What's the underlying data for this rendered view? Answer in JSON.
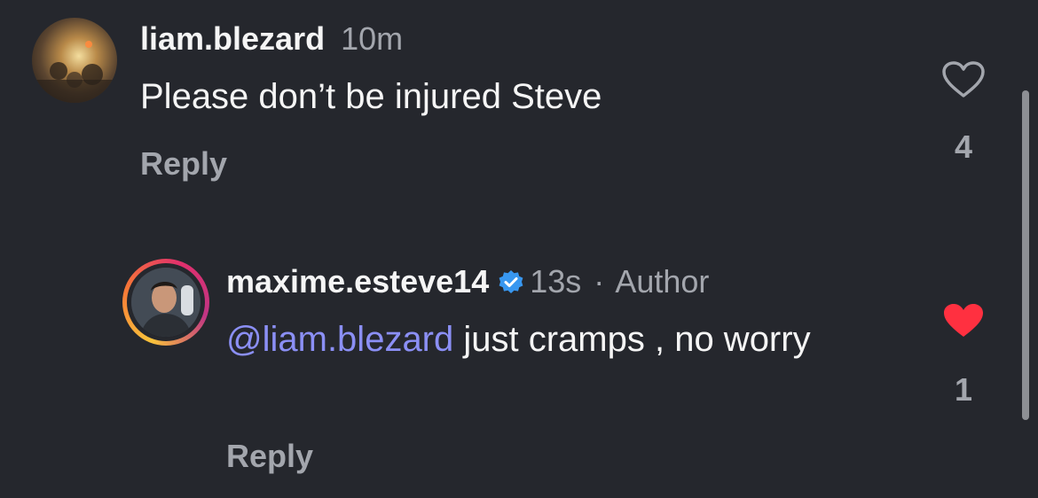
{
  "comments": [
    {
      "username": "liam.blezard",
      "time": "10m",
      "text": "Please don’t be injured Steve",
      "reply_label": "Reply",
      "likes": "4",
      "liked": false
    },
    {
      "username": "maxime.esteve14",
      "verified": true,
      "time": "13s",
      "separator": "·",
      "author_label": "Author",
      "mention": "@liam.blezard",
      "text": " just cramps , no worry",
      "reply_label": "Reply",
      "likes": "1",
      "liked": true
    }
  ],
  "colors": {
    "background": "#25272d",
    "text_primary": "#f5f5f5",
    "text_secondary": "#a3a6ad",
    "mention": "#8b8ff5",
    "verified": "#3897f0",
    "liked_heart": "#ff3040"
  },
  "icons": {
    "like_outline": "heart-outline-icon",
    "like_filled": "heart-filled-icon",
    "verified": "verified-badge-icon"
  }
}
